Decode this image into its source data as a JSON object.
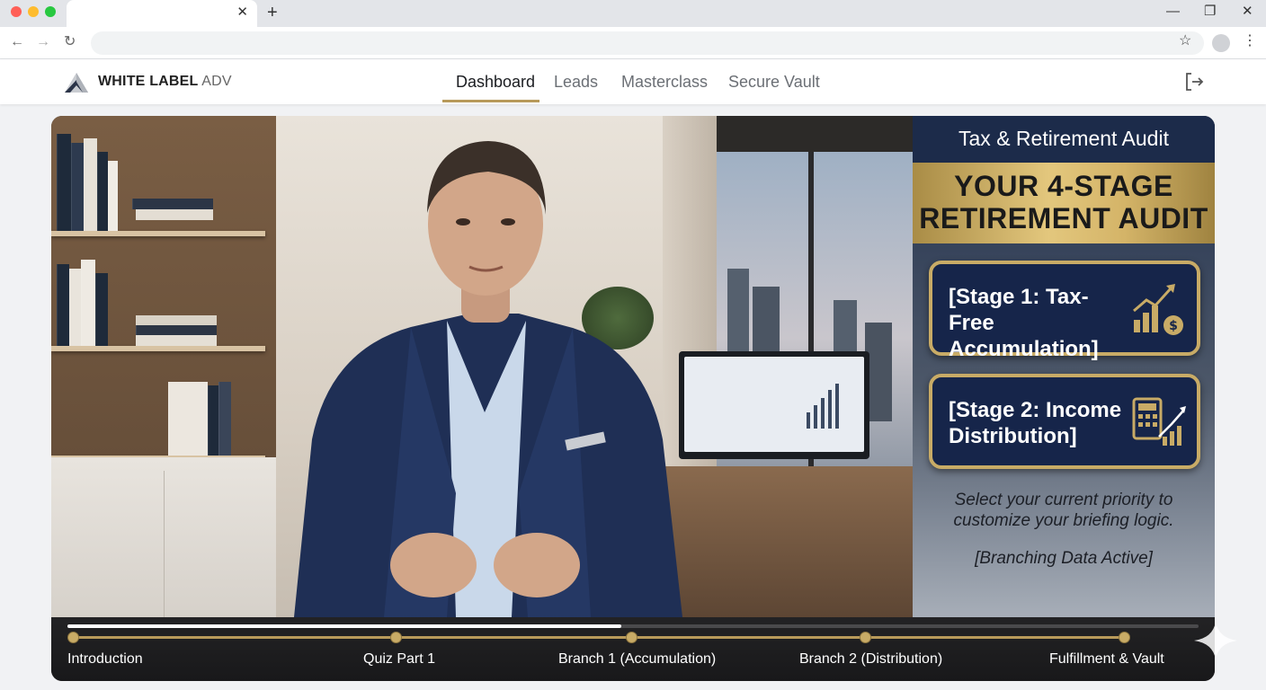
{
  "browser": {
    "tab_close": "✕",
    "new_tab": "+",
    "window_controls": {
      "minimize": "—",
      "maximize": "❐",
      "close": "✕"
    },
    "nav": {
      "back": "←",
      "forward": "→",
      "reload": "↻"
    },
    "address": {
      "value": "",
      "placeholder": ""
    },
    "bookmark": "☆",
    "menu": "⋮"
  },
  "header": {
    "brand_bold": "WHITE LABEL",
    "brand_light": "ADV",
    "tabs": [
      {
        "label": "Dashboard",
        "active": true
      },
      {
        "label": "Leads",
        "active": false
      },
      {
        "label": "Masterclass",
        "active": false
      },
      {
        "label": "Secure Vault",
        "active": false
      }
    ],
    "accent_color": "#b89a5a"
  },
  "panel": {
    "heading": "Tax & Retirement Audit",
    "banner_line1": "YOUR 4-STAGE",
    "banner_line2": "RETIREMENT AUDIT",
    "stages": [
      {
        "line1": "[Stage 1: Tax-Free",
        "line2": "Accumulation]",
        "icon": "growth-chart-dollar-icon"
      },
      {
        "line1": "[Stage 2: Income",
        "line2": "Distribution]",
        "icon": "calculator-chart-icon"
      }
    ],
    "note_line1": "Select your current priority to",
    "note_line2": "customize your briefing logic.",
    "status": "[Branching Data Active]",
    "colors": {
      "navy": "#16254a",
      "gold": "#c8ab66"
    }
  },
  "player": {
    "progress_fraction": 0.49,
    "chapters": [
      {
        "label": "Introduction"
      },
      {
        "label": "Quiz Part 1"
      },
      {
        "label": "Branch 1 (Accumulation)"
      },
      {
        "label": "Branch 2 (Distribution)"
      },
      {
        "label": "Fulfillment & Vault"
      }
    ]
  }
}
